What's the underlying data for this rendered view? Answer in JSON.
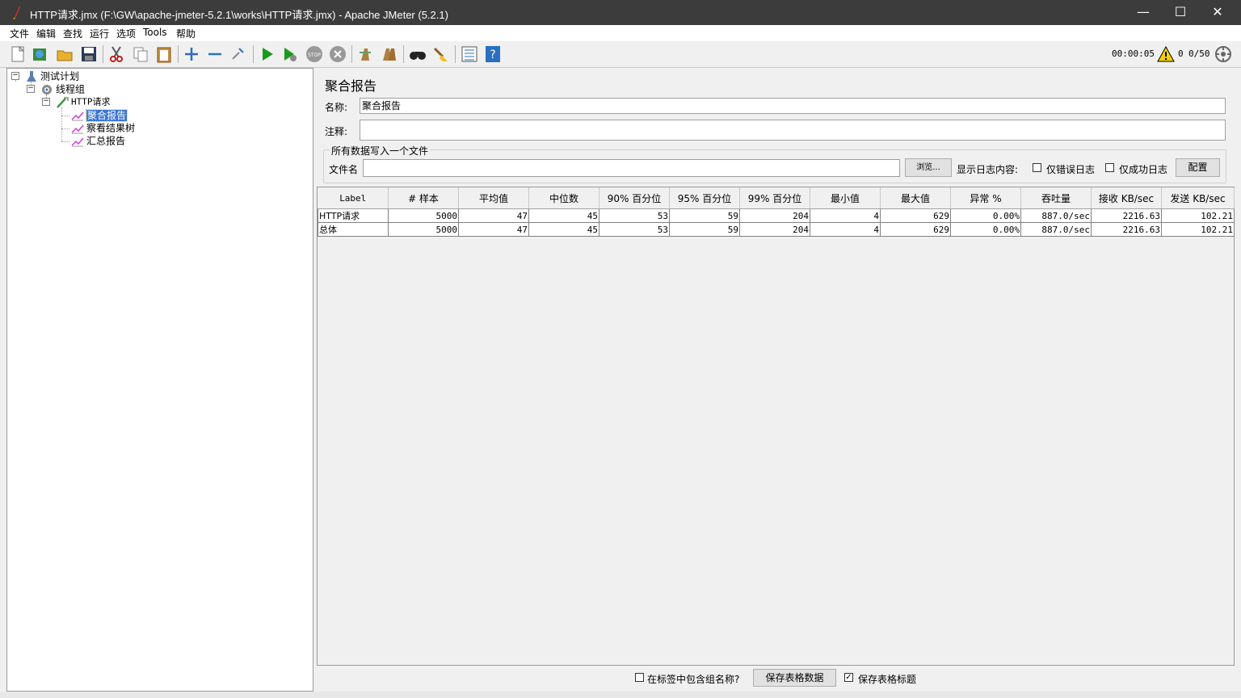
{
  "window": {
    "title": "HTTP请求.jmx (F:\\GW\\apache-jmeter-5.2.1\\works\\HTTP请求.jmx) - Apache JMeter (5.2.1)",
    "minimize": "—",
    "maximize": "☐",
    "close": "✕"
  },
  "menu": [
    "文件",
    "编辑",
    "查找",
    "运行",
    "选项",
    "Tools",
    "帮助"
  ],
  "toolbar": {
    "elapsed": "00:00:05",
    "warnings": "0",
    "threads": "0/50",
    "icons": [
      "new-icon",
      "templates-icon",
      "open-icon",
      "save-icon",
      "cut-icon",
      "copy-icon",
      "paste-icon",
      "expand-icon",
      "collapse-icon",
      "toggle-icon",
      "start-icon",
      "start-no-pauses-icon",
      "stop-icon",
      "shutdown-icon",
      "clear-icon",
      "clear-all-icon",
      "search-icon",
      "reset-search-icon",
      "function-helper-icon",
      "help-icon"
    ]
  },
  "tree": {
    "nodes": [
      {
        "label": "测试计划",
        "icon": "test-plan-icon"
      },
      {
        "label": "线程组",
        "icon": "thread-group-icon"
      },
      {
        "label": "HTTP请求",
        "icon": "http-sampler-icon"
      },
      {
        "label": "聚合报告",
        "icon": "listener-icon",
        "selected": true
      },
      {
        "label": "察看结果树",
        "icon": "listener-icon"
      },
      {
        "label": "汇总报告",
        "icon": "listener-icon"
      }
    ]
  },
  "panel": {
    "title": "聚合报告",
    "name_label": "名称:",
    "name_value": "聚合报告",
    "comment_label": "注释:",
    "comment_value": "",
    "file_group_label": "所有数据写入一个文件",
    "filename_label": "文件名",
    "filename_value": "",
    "browse_label": "浏览...",
    "log_content_label": "显示日志内容:",
    "errors_only_label": "仅错误日志",
    "success_only_label": "仅成功日志",
    "configure_label": "配置"
  },
  "table": {
    "columns": [
      "Label",
      "# 样本",
      "平均值",
      "中位数",
      "90% 百分位",
      "95% 百分位",
      "99% 百分位",
      "最小值",
      "最大值",
      "异常 %",
      "吞吐量",
      "接收 KB/sec",
      "发送 KB/sec"
    ],
    "rows": [
      [
        "HTTP请求",
        "5000",
        "47",
        "45",
        "53",
        "59",
        "204",
        "4",
        "629",
        "0.00%",
        "887.0/sec",
        "2216.63",
        "102.21"
      ],
      [
        "总体",
        "5000",
        "47",
        "45",
        "53",
        "59",
        "204",
        "4",
        "629",
        "0.00%",
        "887.0/sec",
        "2216.63",
        "102.21"
      ]
    ]
  },
  "bottom": {
    "include_group_label": "在标签中包含组名称?",
    "include_group_checked": false,
    "save_table_label": "保存表格数据",
    "save_header_label": "保存表格标题",
    "save_header_checked": true
  }
}
